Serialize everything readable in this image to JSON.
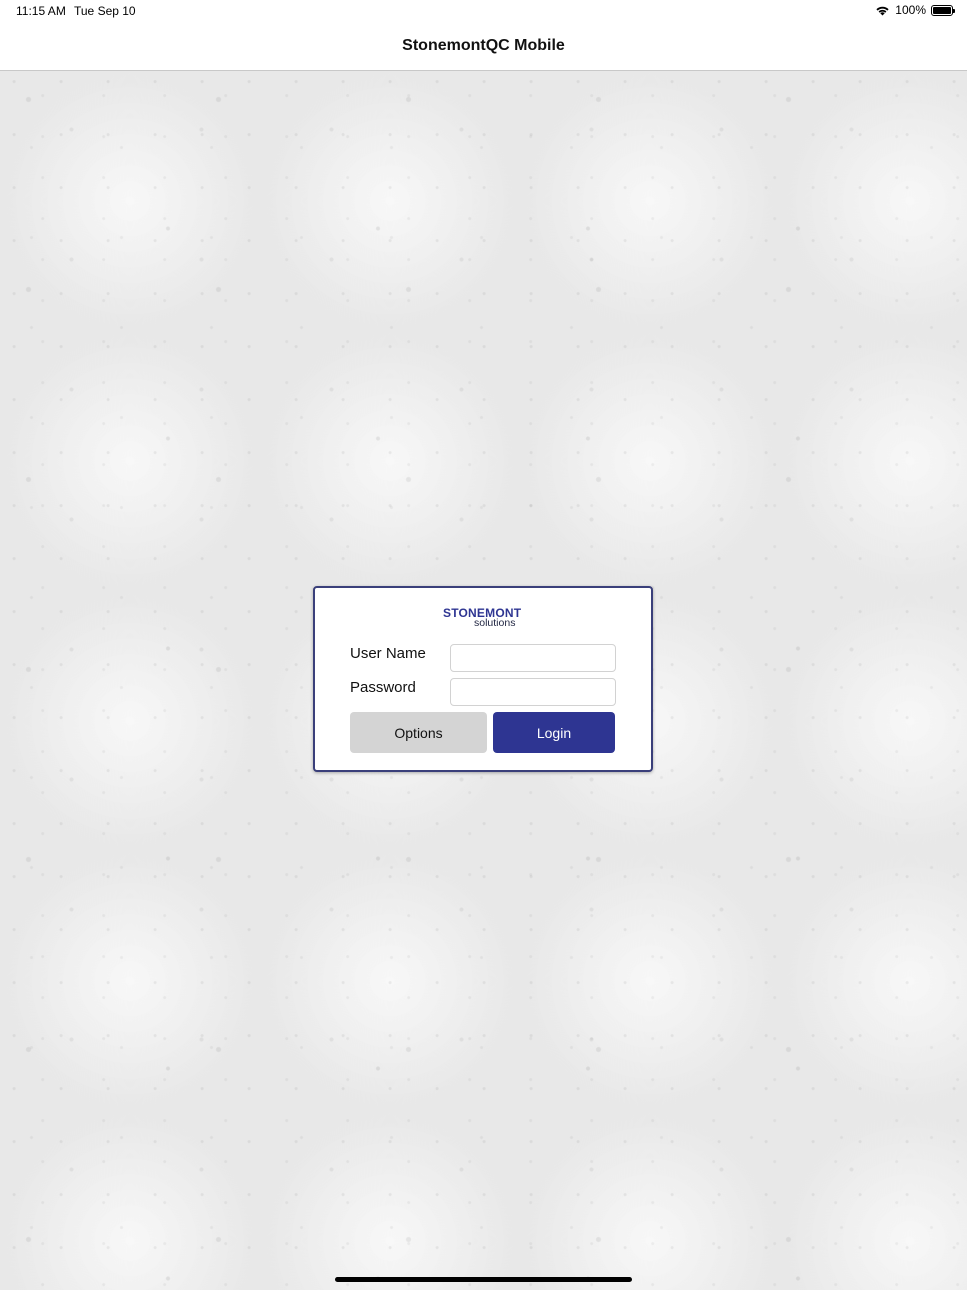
{
  "status_bar": {
    "time": "11:15 AM",
    "date": "Tue Sep 10",
    "battery_percent": "100%",
    "battery_level": 1.0,
    "icons": [
      "wifi-icon",
      "battery-icon"
    ]
  },
  "nav": {
    "title": "StonemontQC Mobile"
  },
  "login": {
    "logo_main": "STONEMONT",
    "logo_sub": "solutions",
    "username_label": "User Name",
    "username_value": "",
    "password_label": "Password",
    "password_value": "",
    "options_label": "Options",
    "login_label": "Login"
  },
  "colors": {
    "brand": "#2e3592",
    "options_button": "#d4d4d4",
    "background": "#efefef"
  }
}
